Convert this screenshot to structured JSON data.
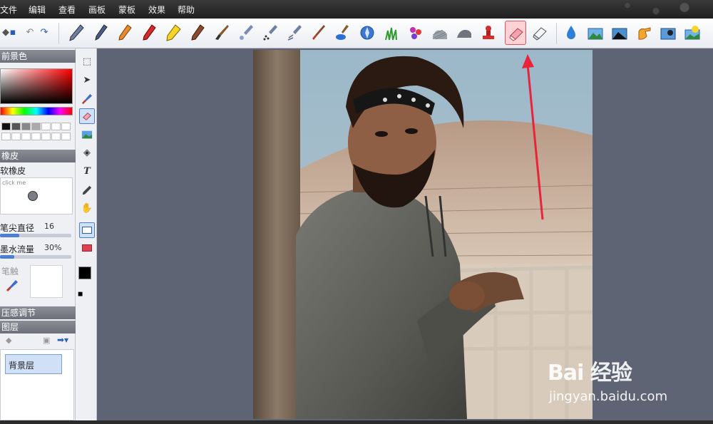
{
  "menu": {
    "items": [
      "文件",
      "编辑",
      "查看",
      "画板",
      "蒙板",
      "效果",
      "帮助"
    ]
  },
  "toolbar": {
    "tools": [
      "pencil",
      "pen",
      "crayon",
      "red-crayon",
      "yellow-marker",
      "brown-marker",
      "brush",
      "airbrush",
      "spray-dots",
      "spray-can",
      "thin-brush",
      "paint-bucket",
      "blue-globe",
      "grass-brush",
      "flower-brush",
      "texture-brush",
      "gray-smudge",
      "stamp",
      "eraser-pink",
      "eraser-white",
      "water-drop",
      "landscape-blue",
      "landscape-dark",
      "hand-yellow",
      "image-effect",
      "sun-effect"
    ],
    "active_tool": "eraser-pink",
    "active_color": "#e25262"
  },
  "left_panel": {
    "foreground_title": "前景色",
    "eraser_title": "橡皮",
    "eraser_type": "软橡皮",
    "click_me": "click me",
    "brush_size_label": "笔尖直径",
    "brush_size_value": "16",
    "ink_flow_label": "墨水流量",
    "ink_flow_value": "30%",
    "brush_tip_label": "笔触",
    "pressure_title": "压感调节",
    "layer_title": "图层",
    "layer_name": "背景层",
    "brush_size_level": 0.27,
    "ink_flow_level": 0.2
  },
  "watermark": {
    "logo": "Bai 经验",
    "url": "jingyan.baidu.com"
  },
  "colors": {
    "accent": "#4a7fd3",
    "canvas_bg": "#5e6473",
    "annotation_arrow": "#e8243a"
  }
}
